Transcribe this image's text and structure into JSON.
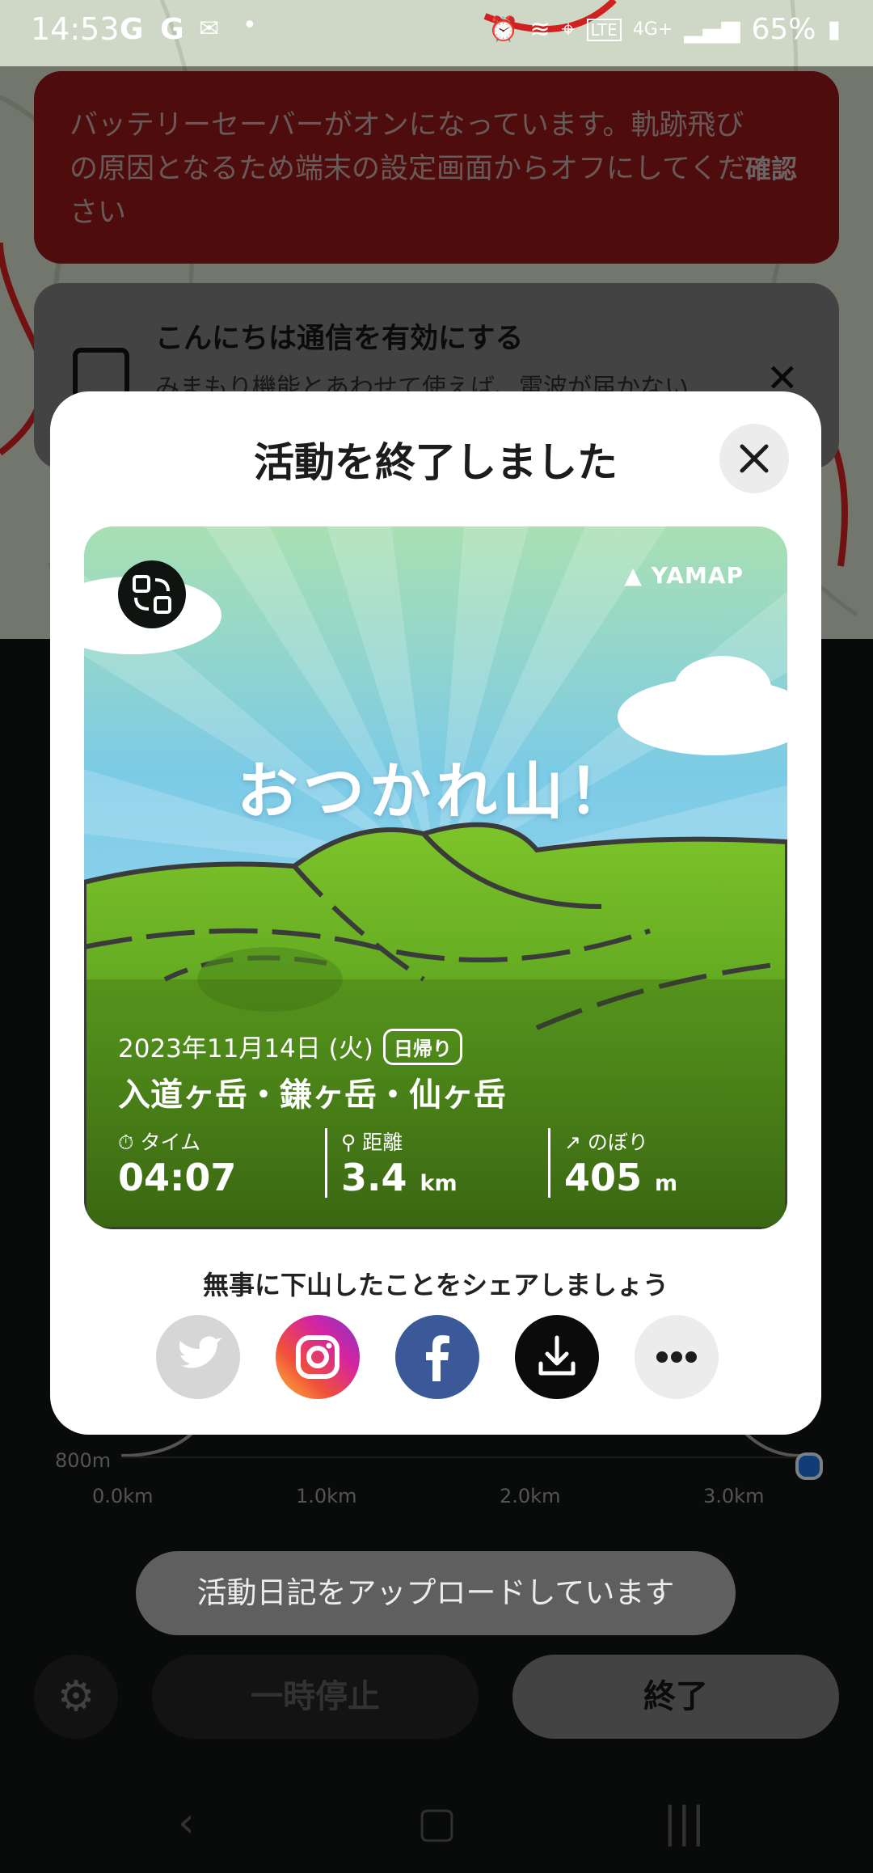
{
  "status_bar": {
    "time": "14:53",
    "left_icons": "G G",
    "battery_percent": "65%"
  },
  "battery_banner": {
    "message": "バッテリーセーバーがオンになっています。軌跡飛びの原因となるため端末の設定画面からオフにしてください",
    "confirm_label": "確認"
  },
  "connect_card": {
    "title": "こんにちは通信を有効にする",
    "subtitle": "みまもり機能とあわせて使えば、電波が届かない"
  },
  "background": {
    "elevation_axis_label": "800m",
    "distance_ticks": [
      "0.0km",
      "1.0km",
      "2.0km",
      "3.0km"
    ],
    "upload_toast": "活動日記をアップロードしています",
    "pause_label": "一時停止",
    "end_label": "終了"
  },
  "modal": {
    "title": "活動を終了しました",
    "card": {
      "brand": "YAMAP",
      "headline": "おつかれ山！",
      "date": "2023年11月14日 (火)",
      "badge": "日帰り",
      "peaks": "入道ヶ岳・鎌ヶ岳・仙ヶ岳",
      "stats": {
        "time_label": "タイム",
        "time_value": "04:07",
        "distance_label": "距離",
        "distance_value": "3.4",
        "distance_unit": "km",
        "climb_label": "のぼり",
        "climb_value": "405",
        "climb_unit": "m"
      }
    },
    "share_prompt": "無事に下山したことをシェアしましょう",
    "share_buttons": [
      "twitter",
      "instagram",
      "facebook",
      "download",
      "more"
    ]
  },
  "colors": {
    "banner_red": "#8e1616",
    "facebook_blue": "#3b5998",
    "twitter_gray": "#d6d6d6",
    "card_green": "#4b9a1c"
  }
}
